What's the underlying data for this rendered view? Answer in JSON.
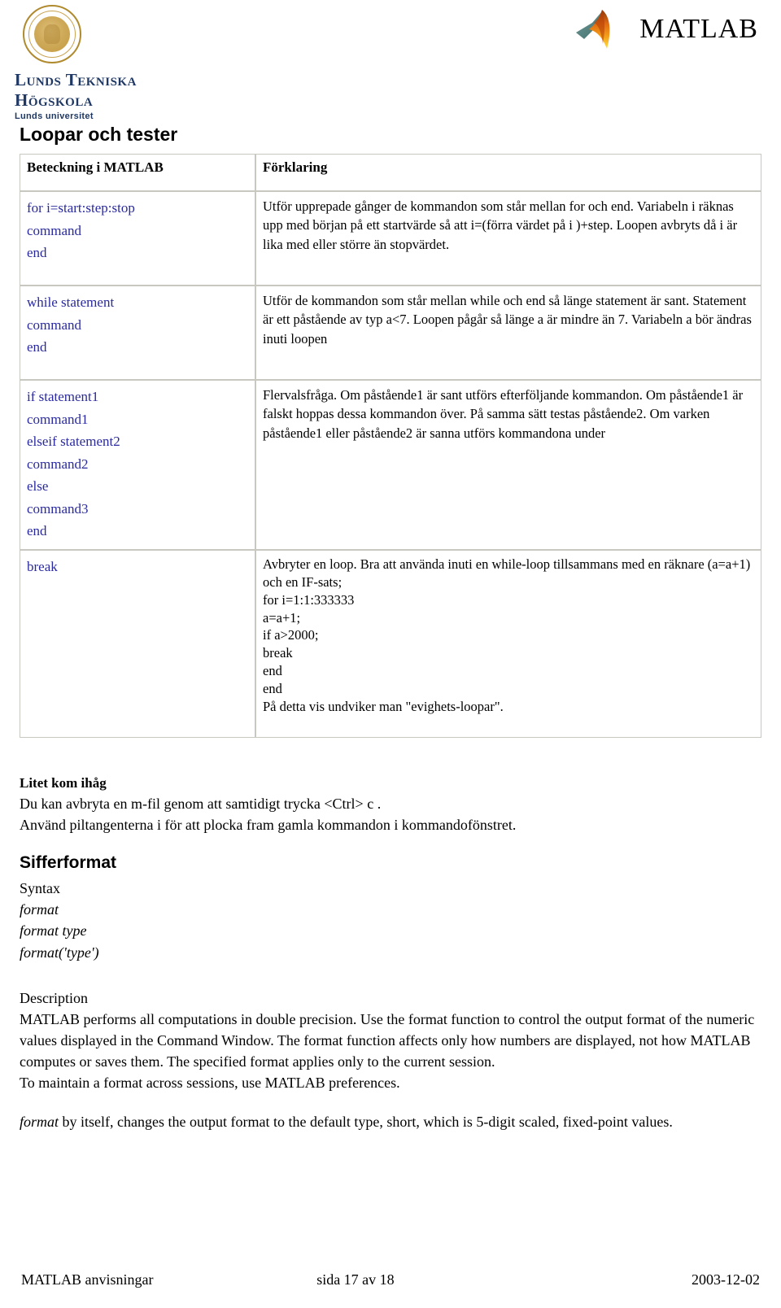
{
  "header": {
    "university_name": "Lunds Tekniska Högskola",
    "university_sub": "Lunds universitet",
    "seal_icon": "lund-university-seal-icon",
    "product_logo_icon": "matlab-membrane-icon",
    "product_name": "MATLAB"
  },
  "sections": {
    "loops_title": "Loopar och tester",
    "number_format_title": "Sifferformat"
  },
  "table": {
    "headers": [
      "Beteckning i MATLAB",
      "Förklaring"
    ],
    "rows": [
      {
        "code": "for i=start:step:stop\ncommand\nend",
        "desc": "Utför upprepade gånger de kommandon som står mellan for och end. Variabeln i räknas upp med början på ett startvärde så att i=(förra värdet på i )+step. Loopen avbryts då i är lika med eller större än stopvärdet."
      },
      {
        "code": "while statement\ncommand\nend",
        "desc": "Utför de kommandon som står mellan while och end så länge statement är sant. Statement är ett påstående av typ a<7. Loopen pågår så länge a är mindre än 7. Variabeln a bör ändras inuti loopen"
      },
      {
        "code": "if statement1\ncommand1\nelseif statement2\ncommand2\nelse\ncommand3\nend",
        "desc": "Flervalsfråga. Om påstående1 är sant utförs efterföljande kommandon. Om påstående1 är falskt hoppas dessa kommandon över. På samma sätt testas påstående2. Om varken påstående1 eller påstående2 är sanna utförs kommandona under"
      },
      {
        "code": "break",
        "desc": "Avbryter en loop. Bra att använda inuti en while-loop tillsammans med en räknare (a=a+1) och en IF-sats;\nfor i=1:1:333333\na=a+1;\nif a>2000;\nbreak\nend\nend\nPå detta vis undviker man \"evighets-loopar\"."
      }
    ]
  },
  "note": {
    "title": "Litet kom ihåg",
    "line1": "Du kan avbryta en m-fil genom att samtidigt trycka <Ctrl> c .",
    "line2": "Använd piltangenterna i för att plocka fram gamla kommandon i kommandofönstret."
  },
  "syntax": {
    "label": "Syntax",
    "line1": "format",
    "line2": "format type",
    "line3": "format('type')"
  },
  "description": {
    "heading": "Description",
    "body": "MATLAB performs all computations in double precision. Use the format function to control the output format of the numeric values displayed in the Command Window. The format function affects only how numbers are displayed, not how MATLAB computes or saves them. The specified format applies only to the current session.",
    "body2": "To maintain a format across sessions, use MATLAB preferences.",
    "tail_italic": "format",
    "tail_rest": " by itself, changes the output format to the default type, short, which is 5-digit scaled, fixed-point values."
  },
  "footer": {
    "left": "MATLAB anvisningar",
    "middle": "sida 17 av 18",
    "right": "2003-12-02"
  }
}
